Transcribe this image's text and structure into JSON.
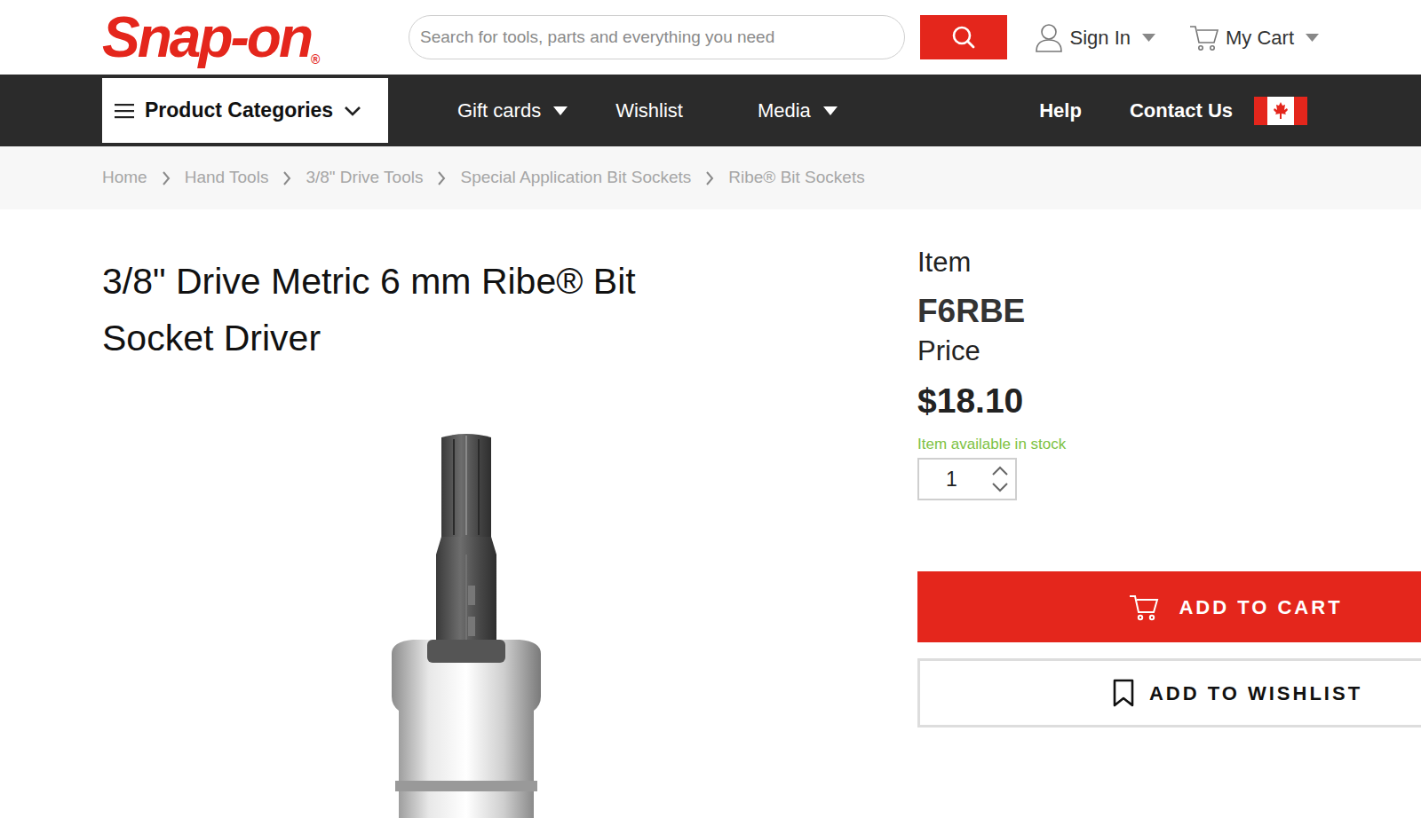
{
  "header": {
    "logo": "Snap-on",
    "logo_mark": "®",
    "search": {
      "placeholder": "Search for tools, parts and everything you need"
    },
    "sign_in": "Sign In",
    "cart": "My Cart"
  },
  "nav": {
    "categories": "Product Categories",
    "items": [
      {
        "label": "Gift cards",
        "dropdown": true
      },
      {
        "label": "Wishlist",
        "dropdown": false
      },
      {
        "label": "Media",
        "dropdown": true
      },
      {
        "label": "Help",
        "dropdown": false
      },
      {
        "label": "Contact Us",
        "dropdown": false
      }
    ]
  },
  "breadcrumb": [
    "Home",
    "Hand Tools",
    "3/8\" Drive Tools",
    "Special Application Bit Sockets",
    "Ribe® Bit Sockets"
  ],
  "product": {
    "title": "3/8\" Drive Metric 6 mm Ribe® Bit Socket Driver",
    "item_label": "Item",
    "item": "F6RBE",
    "price_label": "Price",
    "price": "$18.10",
    "stock": "Item available in stock",
    "quantity": "1",
    "add_to_cart": "ADD TO CART",
    "add_to_wishlist": "ADD TO WISHLIST"
  }
}
